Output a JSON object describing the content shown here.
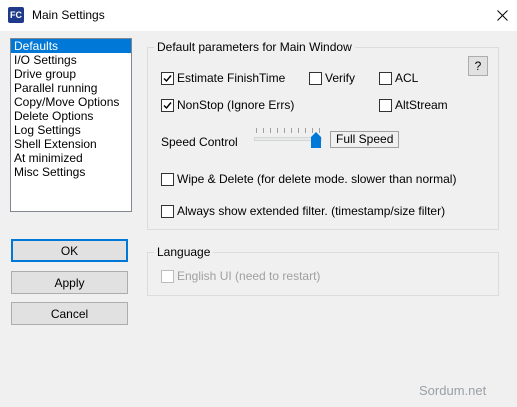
{
  "window": {
    "title": "Main Settings",
    "icon": "FC",
    "close_icon": "close-icon"
  },
  "sidebar": {
    "items": [
      {
        "label": "Defaults",
        "selected": true
      },
      {
        "label": "I/O Settings",
        "selected": false
      },
      {
        "label": "Drive group",
        "selected": false
      },
      {
        "label": "Parallel running",
        "selected": false
      },
      {
        "label": "Copy/Move Options",
        "selected": false
      },
      {
        "label": "Delete Options",
        "selected": false
      },
      {
        "label": "Log Settings",
        "selected": false
      },
      {
        "label": "Shell Extension",
        "selected": false
      },
      {
        "label": "At minimized",
        "selected": false
      },
      {
        "label": "Misc Settings",
        "selected": false
      }
    ]
  },
  "buttons": {
    "ok": "OK",
    "apply": "Apply",
    "cancel": "Cancel"
  },
  "main_group": {
    "title": "Default parameters for Main Window",
    "help_label": "?",
    "estimate_finishtime": {
      "label": "Estimate FinishTime",
      "checked": true
    },
    "verify": {
      "label": "Verify",
      "checked": false
    },
    "acl": {
      "label": "ACL",
      "checked": false
    },
    "nonstop": {
      "label": "NonStop (Ignore Errs)",
      "checked": true
    },
    "altstream": {
      "label": "AltStream",
      "checked": false
    },
    "speed_control": {
      "label": "Speed Control",
      "value_text": "Full Speed",
      "level": 1.0
    },
    "wipe_delete": {
      "label": "Wipe & Delete (for delete mode. slower than normal)",
      "checked": false
    },
    "extended_filter": {
      "label": "Always show extended filter. (timestamp/size filter)",
      "checked": false
    }
  },
  "language_group": {
    "title": "Language",
    "english_ui": {
      "label": "English UI (need to restart)",
      "checked": false,
      "disabled": true
    }
  },
  "watermark": "Sordum.net",
  "colors": {
    "selection": "#0078d7",
    "default_button_border": "#0078d7",
    "slider_thumb": "#0078d7"
  }
}
